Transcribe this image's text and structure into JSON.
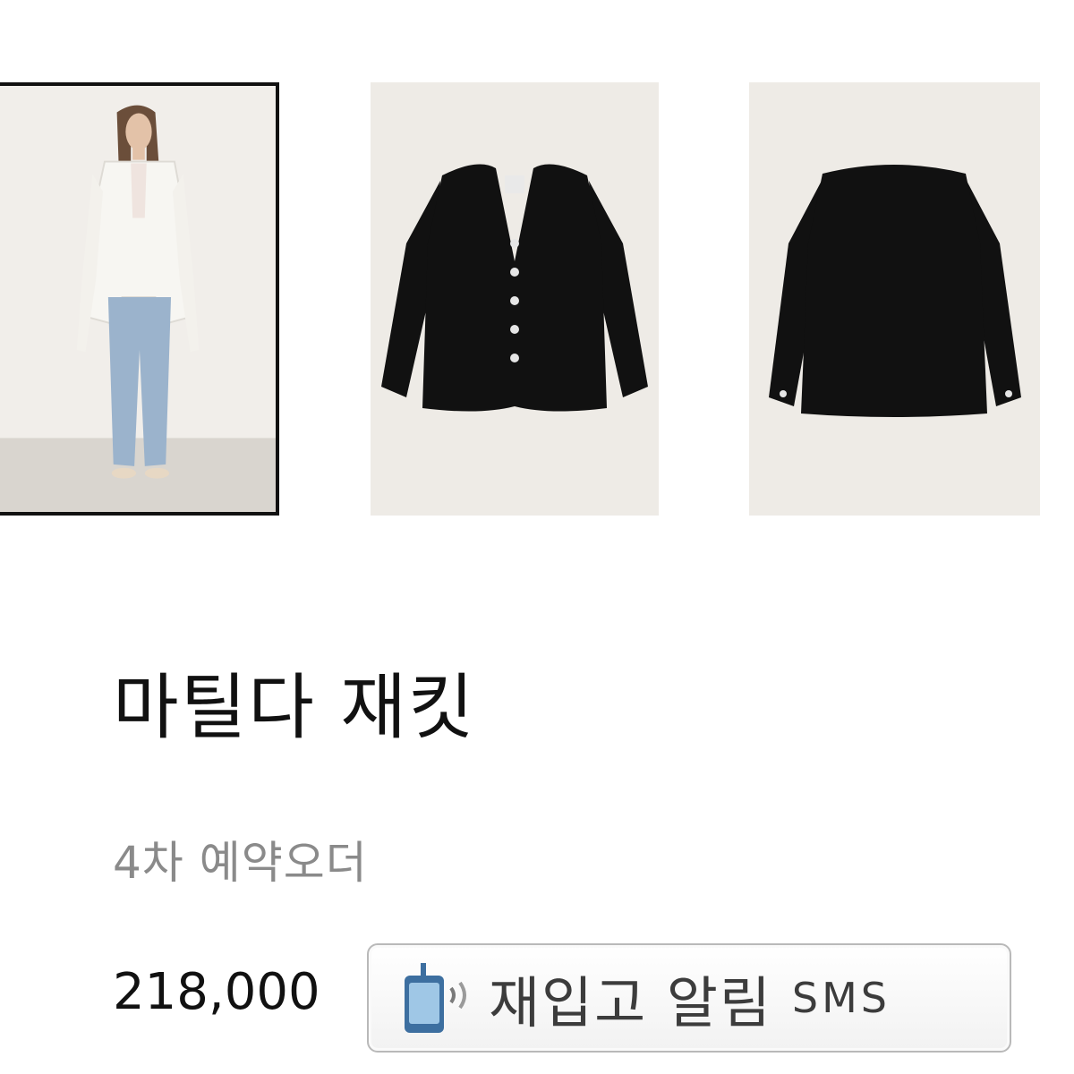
{
  "gallery": {
    "thumbnails": [
      {
        "name": "model-wearing-white-jacket",
        "selected": true
      },
      {
        "name": "black-jacket-front",
        "selected": false
      },
      {
        "name": "black-jacket-back",
        "selected": false
      }
    ]
  },
  "product": {
    "title": "마틸다 재킷",
    "subtitle": "4차 예약오더",
    "price": "218,000"
  },
  "restock_button": {
    "label": "재입고 알림",
    "sms": "SMS",
    "icon": "phone-icon"
  },
  "colors": {
    "thumb_bg": "#eeebe6",
    "jacket": "#111111",
    "subtitle": "#8a8a8a",
    "button_border": "#b9b9b9"
  }
}
